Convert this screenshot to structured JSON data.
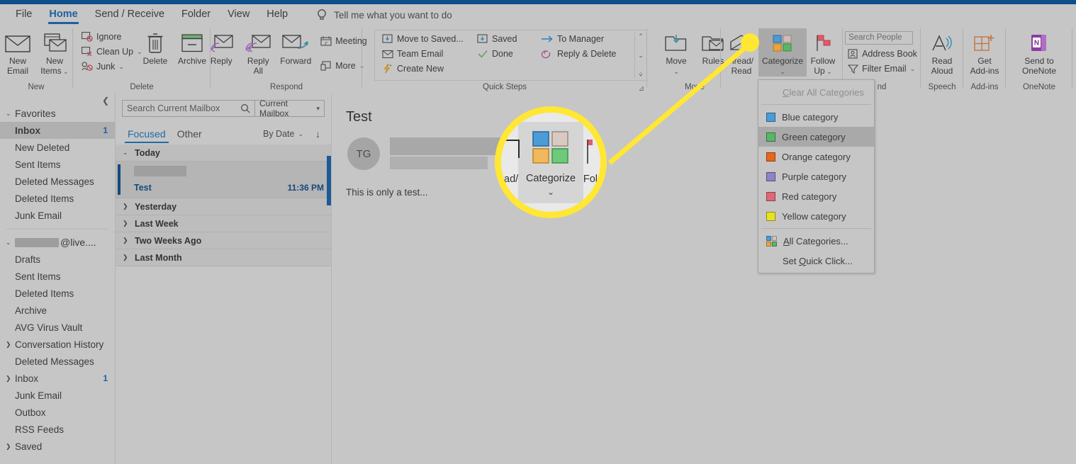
{
  "app": {
    "accent_blue": "#0d4f8b",
    "highlight_yellow": "#ffe734"
  },
  "tabs": [
    {
      "label": "File",
      "active": false
    },
    {
      "label": "Home",
      "active": true
    },
    {
      "label": "Send / Receive",
      "active": false
    },
    {
      "label": "Folder",
      "active": false
    },
    {
      "label": "View",
      "active": false
    },
    {
      "label": "Help",
      "active": false
    }
  ],
  "tellme": {
    "icon": "lightbulb-icon",
    "label": "Tell me what you want to do"
  },
  "ribbon": {
    "groups": [
      {
        "name": "New",
        "label": "New"
      },
      {
        "name": "Delete",
        "label": "Delete"
      },
      {
        "name": "Respond",
        "label": "Respond"
      },
      {
        "name": "QuickSteps",
        "label": "Quick Steps"
      },
      {
        "name": "Move",
        "label": "Move"
      },
      {
        "name": "Tags",
        "label": ""
      },
      {
        "name": "Find",
        "label": "nd"
      },
      {
        "name": "Speech",
        "label": "Speech"
      },
      {
        "name": "AddIns",
        "label": "Add-ins"
      },
      {
        "name": "OneNote",
        "label": "OneNote"
      }
    ],
    "new_group": {
      "new_email": "New\nEmail",
      "new_items": "New\nItems"
    },
    "delete_group": {
      "ignore": "Ignore",
      "clean_up": "Clean Up",
      "junk": "Junk",
      "delete": "Delete",
      "archive": "Archive"
    },
    "respond_group": {
      "reply": "Reply",
      "reply_all": "Reply\nAll",
      "forward": "Forward",
      "meeting": "Meeting",
      "more": "More"
    },
    "quick_steps": {
      "items": [
        "Move to Saved...",
        "Team Email",
        "Create New",
        "Saved",
        "Done",
        "To Manager",
        "Reply & Delete"
      ]
    },
    "move_group": {
      "move": "Move",
      "rules": "Rules",
      "unread_read": "nread/\nRead"
    },
    "tags_group": {
      "categorize": "Categorize",
      "follow_up": "Follow\nUp"
    },
    "find_group": {
      "search_people_placeholder": "Search People",
      "address_book": "Address Book",
      "filter_email": "Filter Email"
    },
    "speech_group": {
      "read_aloud": "Read\nAloud"
    },
    "addins_group": {
      "get_addins": "Get\nAdd-ins"
    },
    "onenote_group": {
      "send_to_onenote": "Send to\nOneNote"
    }
  },
  "nav": {
    "favorites": {
      "label": "Favorites"
    },
    "favorite_items": [
      {
        "label": "Inbox",
        "count": "1",
        "selected": true
      },
      {
        "label": "New Deleted",
        "count": "",
        "selected": false
      },
      {
        "label": "Sent Items",
        "count": "",
        "selected": false
      },
      {
        "label": "Deleted Messages",
        "count": "",
        "selected": false
      },
      {
        "label": "Deleted Items",
        "count": "",
        "selected": false
      },
      {
        "label": "Junk Email",
        "count": "",
        "selected": false
      }
    ],
    "account": {
      "label": "@live....",
      "redacted": true
    },
    "account_items": [
      {
        "label": "Drafts",
        "count": "",
        "expandable": false
      },
      {
        "label": "Sent Items",
        "count": "",
        "expandable": false
      },
      {
        "label": "Deleted Items",
        "count": "",
        "expandable": false
      },
      {
        "label": "Archive",
        "count": "",
        "expandable": false
      },
      {
        "label": "AVG Virus Vault",
        "count": "",
        "expandable": false
      },
      {
        "label": "Conversation History",
        "count": "",
        "expandable": true
      },
      {
        "label": "Deleted Messages",
        "count": "",
        "expandable": false
      },
      {
        "label": "Inbox",
        "count": "1",
        "expandable": true
      },
      {
        "label": "Junk Email",
        "count": "",
        "expandable": false
      },
      {
        "label": "Outbox",
        "count": "",
        "expandable": false
      },
      {
        "label": "RSS Feeds",
        "count": "",
        "expandable": false
      },
      {
        "label": "Saved",
        "count": "",
        "expandable": true
      }
    ]
  },
  "list": {
    "search_placeholder": "Search Current Mailbox",
    "scope": "Current Mailbox",
    "tabs": [
      {
        "label": "Focused",
        "active": true
      },
      {
        "label": "Other",
        "active": false
      }
    ],
    "sort_by": "By Date",
    "groups": [
      {
        "label": "Today",
        "expanded": true
      },
      {
        "label": "Yesterday",
        "expanded": false
      },
      {
        "label": "Last Week",
        "expanded": false
      },
      {
        "label": "Two Weeks Ago",
        "expanded": false
      },
      {
        "label": "Last Month",
        "expanded": false
      }
    ],
    "message": {
      "sender_redacted": true,
      "subject": "Test",
      "time": "11:36 PM",
      "selected": true
    }
  },
  "reading": {
    "subject": "Test",
    "avatar_initials": "TG",
    "body": "This is only a test..."
  },
  "callout": {
    "button_label": "Categorize",
    "left_fragment": "ad/",
    "right_fragment": "Fol"
  },
  "menu": {
    "clear_all": "Clear All Categories",
    "categories": [
      {
        "label": "Blue category",
        "color": "#4a9cd6",
        "selected": false
      },
      {
        "label": "Green category",
        "color": "#59b765",
        "selected": true
      },
      {
        "label": "Orange category",
        "color": "#e8661a",
        "selected": false
      },
      {
        "label": "Purple category",
        "color": "#8f82c8",
        "selected": false
      },
      {
        "label": "Red category",
        "color": "#df6877",
        "selected": false
      },
      {
        "label": "Yellow category",
        "color": "#e8e222",
        "selected": false
      }
    ],
    "all_categories": "All Categories...",
    "set_quick_click": "Set Quick Click..."
  }
}
